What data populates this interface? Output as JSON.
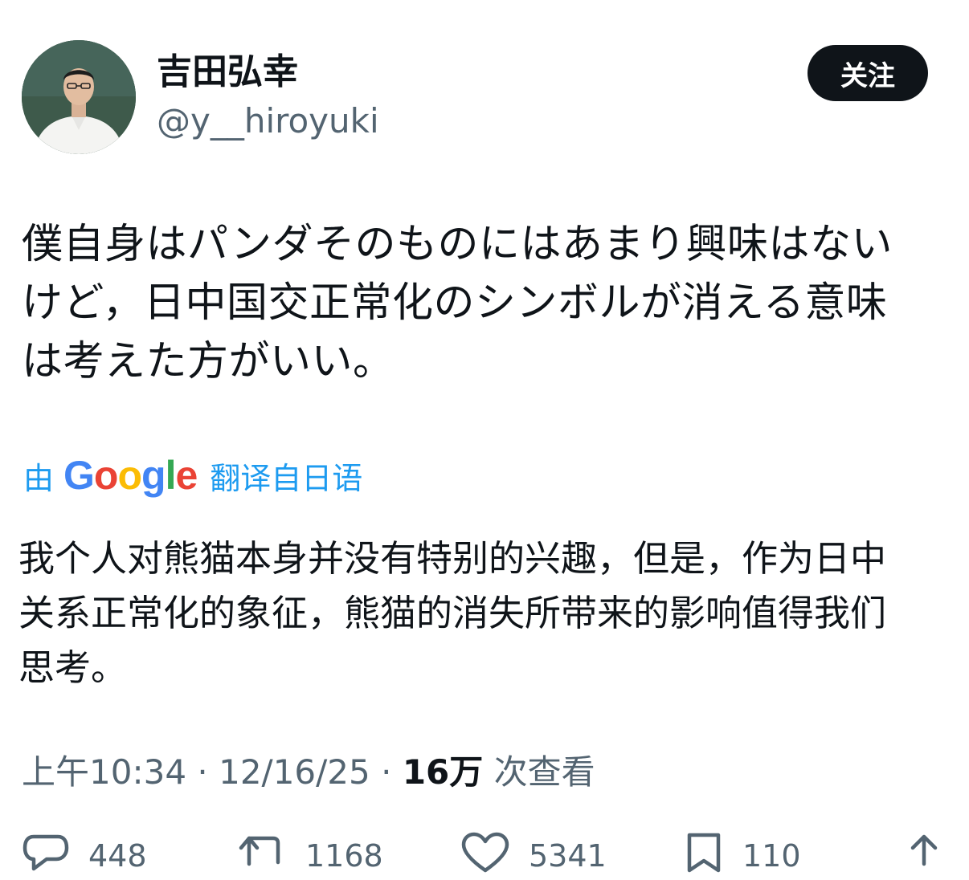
{
  "author": {
    "display_name": "吉田弘幸",
    "handle": "@y__hiroyuki"
  },
  "follow_label": "关注",
  "tweet": {
    "original_text": "僕自身はパンダそのものにはあまり興味はない\nけど，日中国交正常化のシンボルが消える意味\nは考えた方がいい。",
    "translation": {
      "prefix": "由",
      "provider": "Google",
      "suffix": "翻译自日语"
    },
    "translated_text": "我个人对熊猫本身并没有特别的兴趣，但是，作为日中\n关系正常化的象征，熊猫的消失所带来的影响值得我们\n思考。",
    "time": "上午10:34",
    "date": "12/16/25",
    "separator": " · ",
    "views_count": "16万",
    "views_label": " 次查看"
  },
  "actions": {
    "replies": "448",
    "reposts": "1168",
    "likes": "5341",
    "bookmarks": "110"
  },
  "colors": {
    "accent": "#1d9bf0",
    "text_primary": "#0f1419",
    "text_secondary": "#536471",
    "button_bg": "#0f1419"
  },
  "icons": [
    "avatar",
    "reply-icon",
    "repost-icon",
    "like-icon",
    "bookmark-icon",
    "share-icon"
  ]
}
